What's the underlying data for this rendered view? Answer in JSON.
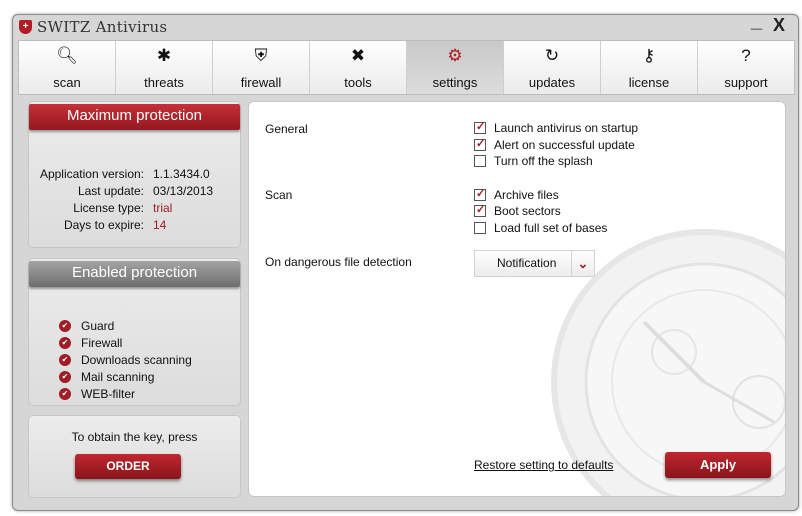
{
  "window": {
    "title": "SWITZ Antivirus",
    "minimize": "_",
    "close": "X"
  },
  "tabs": [
    {
      "label": "scan",
      "icon": "search-icon",
      "glyph": "🔍︎"
    },
    {
      "label": "threats",
      "icon": "bug-icon",
      "glyph": "✱"
    },
    {
      "label": "firewall",
      "icon": "shield-icon",
      "glyph": "⛨"
    },
    {
      "label": "tools",
      "icon": "tools-icon",
      "glyph": "✖"
    },
    {
      "label": "settings",
      "icon": "gears-icon",
      "glyph": "⚙"
    },
    {
      "label": "updates",
      "icon": "refresh-icon",
      "glyph": "↻"
    },
    {
      "label": "license",
      "icon": "key-icon",
      "glyph": "⚷"
    },
    {
      "label": "support",
      "icon": "question-icon",
      "glyph": "?"
    }
  ],
  "active_tab": "settings",
  "protection_panel": {
    "title": "Maximum protection",
    "rows": [
      {
        "label": "Application version:",
        "value": "1.1.3434.0"
      },
      {
        "label": "Last update:",
        "value": "03/13/2013"
      },
      {
        "label": "License type:",
        "value": "trial"
      },
      {
        "label": "Days to expire:",
        "value": "14"
      }
    ]
  },
  "enabled_panel": {
    "title": "Enabled protection",
    "items": [
      "Guard",
      "Firewall",
      "Downloads scanning",
      "Mail scanning",
      "WEB-filter"
    ]
  },
  "key_panel": {
    "text": "To obtain the key, press",
    "button": "ORDER"
  },
  "settings": {
    "general": {
      "label": "General",
      "options": [
        {
          "label": "Launch antivirus on startup",
          "checked": true
        },
        {
          "label": "Alert on successful update",
          "checked": true
        },
        {
          "label": "Turn off the splash",
          "checked": false
        }
      ]
    },
    "scan": {
      "label": "Scan",
      "options": [
        {
          "label": "Archive files",
          "checked": true
        },
        {
          "label": "Boot sectors",
          "checked": true
        },
        {
          "label": "Load full set of bases",
          "checked": false
        }
      ]
    },
    "detection": {
      "label": "On dangerous file detection",
      "value": "Notification"
    }
  },
  "footer": {
    "restore": "Restore setting to defaults",
    "apply": "Apply"
  },
  "colors": {
    "accent": "#a11d25",
    "panel_bg": "#e6e6e6",
    "grey_ribbon": "#8a8a8a"
  }
}
